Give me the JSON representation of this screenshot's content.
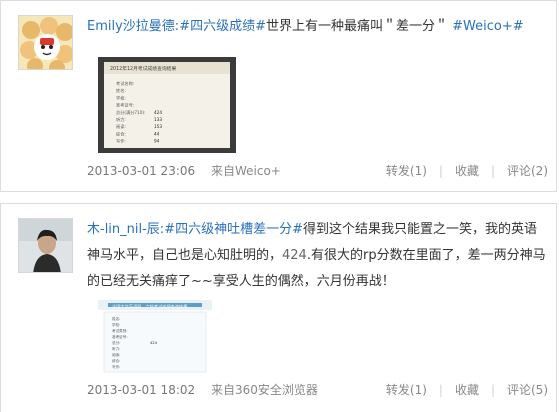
{
  "posts": [
    {
      "author": "Emily沙拉曼德:",
      "tag": "#四六级成绩#",
      "body": "世界上有一种最痛叫＂差一分＂",
      "tag2": "#Weico+#",
      "attachment": {
        "title": "2012年12月考试成绩查询结果",
        "rows": [
          {
            "label": "考试名称:",
            "value": ""
          },
          {
            "label": "姓名:",
            "value": ""
          },
          {
            "label": "学校:",
            "value": ""
          },
          {
            "label": "准考证号:",
            "value": ""
          },
          {
            "label": "总分(满分710):",
            "value": "424"
          },
          {
            "label": "听力:",
            "value": "133"
          },
          {
            "label": "阅读:",
            "value": "153"
          },
          {
            "label": "综合:",
            "value": "44"
          },
          {
            "label": "写作:",
            "value": "94"
          }
        ]
      },
      "time": "2013-03-01 23:06",
      "source_prefix": "来自",
      "source": "Weico+",
      "repost": "转发(1)",
      "favorite": "收藏",
      "comment": "评论(2)"
    },
    {
      "author": "木-lin_nil-辰:",
      "tag": "#四六级神吐槽差一分#",
      "body_a": "得到这个结果我只能置之一笑，我的英语神马水平，自己也是心知肚明的，",
      "score": "424",
      "body_b": ".有很大的rp分数在里面了，差一两分神马的已经无关痛痒了~~享受人生的偶然，六月份再战！",
      "attachment": {
        "title": "全国大学英语四、六级考试成绩查询结果",
        "rows": [
          {
            "label": "姓名:",
            "value": ""
          },
          {
            "label": "学校:",
            "value": ""
          },
          {
            "label": "考试类别:",
            "value": ""
          },
          {
            "label": "准考证号:",
            "value": ""
          },
          {
            "label": "总分:",
            "value": "424"
          },
          {
            "label": "听力:",
            "value": ""
          },
          {
            "label": "阅读:",
            "value": ""
          },
          {
            "label": "综合:",
            "value": ""
          },
          {
            "label": "写作:",
            "value": ""
          }
        ]
      },
      "time": "2013-03-01 18:02",
      "source_prefix": "来自",
      "source": "360安全浏览器",
      "repost": "转发(1)",
      "favorite": "收藏",
      "comment": "评论(5)"
    }
  ],
  "colors": {
    "link": "#2a71b8",
    "meta": "#888888",
    "border": "#dcdcdc"
  }
}
